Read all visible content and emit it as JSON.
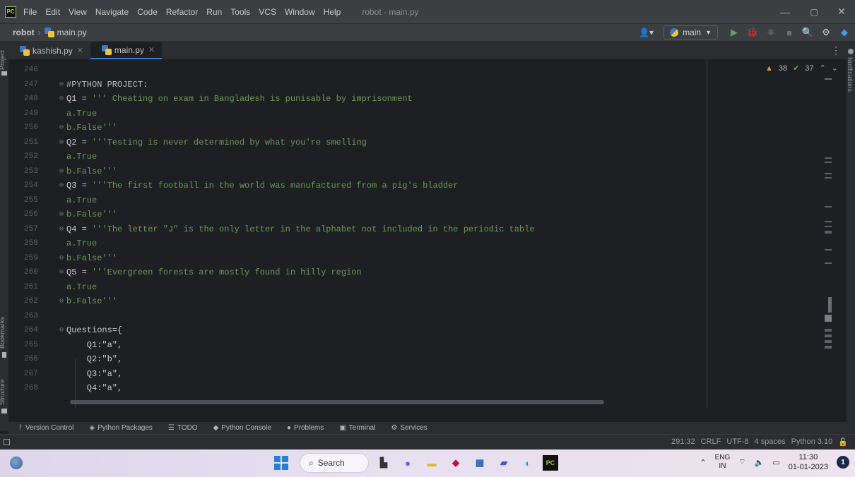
{
  "titlebar": {
    "logo": "PC",
    "menu": [
      "File",
      "Edit",
      "View",
      "Navigate",
      "Code",
      "Refactor",
      "Run",
      "Tools",
      "VCS",
      "Window",
      "Help"
    ],
    "title": "robot - main.py",
    "controls": [
      "—",
      "▢",
      "✕"
    ]
  },
  "navbar": {
    "project": "robot",
    "file": "main.py",
    "branch": "main"
  },
  "left_strip": {
    "project": "Project",
    "bookmarks": "Bookmarks",
    "structure": "Structure"
  },
  "right_strip": {
    "notifications": "Notifications"
  },
  "tabs": [
    {
      "label": "kashish.py"
    },
    {
      "label": "main.py"
    }
  ],
  "inspections": {
    "warnings": "38",
    "weak_warnings": "37"
  },
  "editor": {
    "lines": [
      {
        "no": "246",
        "text": ""
      },
      {
        "no": "247",
        "text": "#PYTHON PROJECT:"
      },
      {
        "no": "248",
        "text": "Q1 = ''' Cheating on exam in Bangladesh is punisable by imprisonment"
      },
      {
        "no": "249",
        "text": "a.True"
      },
      {
        "no": "250",
        "text": "b.False'''"
      },
      {
        "no": "251",
        "text": "Q2 = '''Testing is never determined by what you're smelling"
      },
      {
        "no": "252",
        "text": "a.True"
      },
      {
        "no": "253",
        "text": "b.False'''"
      },
      {
        "no": "254",
        "text": "Q3 = '''The first football in the world was manufactured from a pig's bladder"
      },
      {
        "no": "255",
        "text": "a.True"
      },
      {
        "no": "256",
        "text": "b.False'''"
      },
      {
        "no": "257",
        "text": "Q4 = '''The letter \"J\" is the only letter in the alphabet not included in the periodic table"
      },
      {
        "no": "258",
        "text": "a.True"
      },
      {
        "no": "259",
        "text": "b.False'''"
      },
      {
        "no": "260",
        "text": "Q5 = '''Evergreen forests are mostly found in hilly region"
      },
      {
        "no": "261",
        "text": "a.True"
      },
      {
        "no": "262",
        "text": "b.False'''"
      },
      {
        "no": "263",
        "text": ""
      },
      {
        "no": "264",
        "text": "Questions={"
      },
      {
        "no": "265",
        "text": "    Q1:\"a\","
      },
      {
        "no": "266",
        "text": "    Q2:\"b\","
      },
      {
        "no": "267",
        "text": "    Q3:\"a\","
      },
      {
        "no": "268",
        "text": "    Q4:\"a\","
      }
    ]
  },
  "bottom_tools": [
    "Version Control",
    "Python Packages",
    "TODO",
    "Python Console",
    "Problems",
    "Terminal",
    "Services"
  ],
  "statusbar": {
    "position": "291:32",
    "line_sep": "CRLF",
    "encoding": "UTF-8",
    "indent": "4 spaces",
    "interpreter": "Python 3.10"
  },
  "taskbar": {
    "search": "Search",
    "lang_top": "ENG",
    "lang_bottom": "IN",
    "time": "11:30",
    "date": "01-01-2023",
    "notifications": "1"
  }
}
